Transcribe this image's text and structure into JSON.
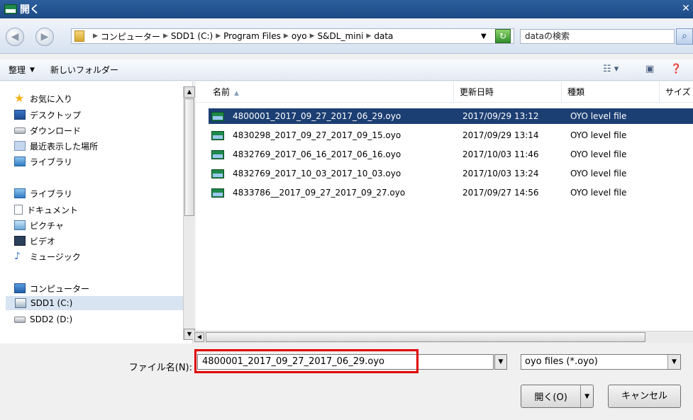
{
  "title": "開く",
  "address": {
    "crumbs": [
      "コンピューター",
      "SDD1 (C:)",
      "Program Files",
      "oyo",
      "S&DL_mini",
      "data"
    ],
    "search_placeholder": "dataの検索"
  },
  "toolbar": {
    "organize": "整理",
    "new_folder": "新しいフォルダー"
  },
  "nav": {
    "favorites": "お気に入り",
    "desktop": "デスクトップ",
    "downloads": "ダウンロード",
    "recent": "最近表示した場所",
    "library_fav": "ライブラリ",
    "libraries": "ライブラリ",
    "documents": "ドキュメント",
    "pictures": "ピクチャ",
    "videos": "ビデオ",
    "music": "ミュージック",
    "computer": "コンピューター",
    "drive_c": "SDD1 (C:)",
    "drive_d": "SDD2 (D:)"
  },
  "columns": {
    "name": "名前",
    "date": "更新日時",
    "type": "種類",
    "size": "サイズ"
  },
  "files": [
    {
      "name": "4800001_2017_09_27_2017_06_29.oyo",
      "date": "2017/09/29 13:12",
      "type": "OYO level file"
    },
    {
      "name": "4830298_2017_09_27_2017_09_15.oyo",
      "date": "2017/09/29 13:14",
      "type": "OYO level file"
    },
    {
      "name": "4832769_2017_06_16_2017_06_16.oyo",
      "date": "2017/10/03 11:46",
      "type": "OYO level file"
    },
    {
      "name": "4832769_2017_10_03_2017_10_03.oyo",
      "date": "2017/10/03 13:24",
      "type": "OYO level file"
    },
    {
      "name": "4833786__2017_09_27_2017_09_27.oyo",
      "date": "2017/09/27 14:56",
      "type": "OYO level file"
    }
  ],
  "bottom": {
    "filename_label": "ファイル名(N):",
    "filename_value": "4800001_2017_09_27_2017_06_29.oyo",
    "filter_value": "oyo files (*.oyo)",
    "open_label": "開く(O)",
    "cancel_label": "キャンセル"
  },
  "colors": {
    "selection": "#1c3f73",
    "highlight": "#e00000"
  }
}
